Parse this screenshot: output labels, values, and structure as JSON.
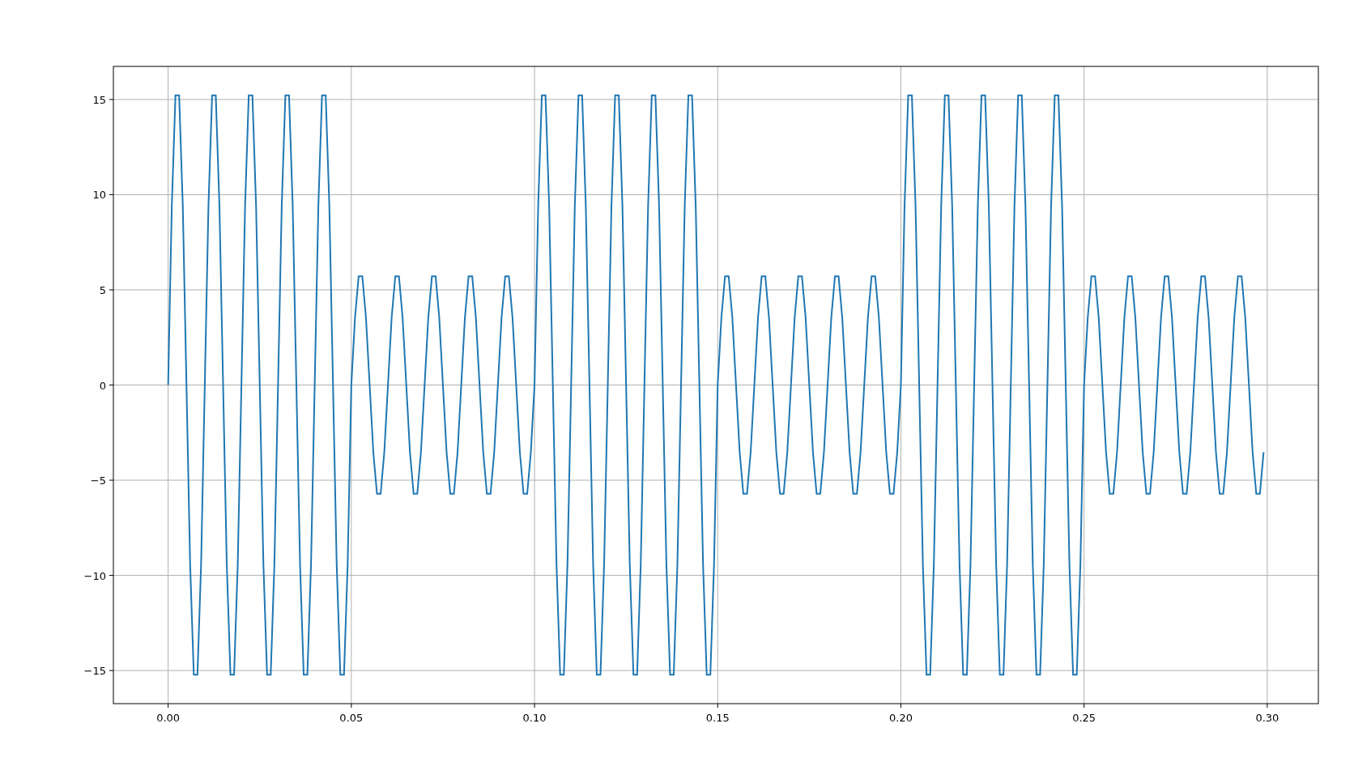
{
  "chart_data": {
    "type": "line",
    "grid": true,
    "x": [
      0,
      0.001,
      0.002,
      0.003,
      0.004,
      0.005,
      0.006,
      0.007,
      0.008,
      0.009,
      0.01,
      0.011,
      0.012,
      0.013,
      0.014,
      0.015,
      0.016,
      0.017,
      0.018,
      0.019,
      0.02,
      0.021,
      0.022,
      0.023,
      0.024,
      0.025,
      0.026,
      0.027,
      0.028,
      0.029,
      0.03,
      0.031,
      0.032,
      0.033,
      0.034,
      0.035,
      0.036,
      0.037,
      0.038,
      0.039,
      0.04,
      0.041,
      0.042,
      0.043,
      0.044,
      0.045,
      0.046,
      0.047,
      0.048,
      0.049,
      0.05,
      0.051,
      0.052,
      0.053,
      0.054,
      0.055,
      0.056,
      0.057,
      0.058,
      0.059,
      0.06,
      0.061,
      0.062,
      0.063,
      0.064,
      0.065,
      0.066,
      0.067,
      0.068,
      0.069,
      0.07,
      0.071,
      0.072,
      0.073,
      0.074,
      0.075,
      0.076,
      0.077,
      0.078,
      0.079,
      0.08,
      0.081,
      0.082,
      0.083,
      0.084,
      0.085,
      0.086,
      0.087,
      0.088,
      0.089,
      0.09,
      0.091,
      0.092,
      0.093,
      0.094,
      0.095,
      0.096,
      0.097,
      0.098,
      0.099,
      0.1,
      0.101,
      0.102,
      0.103,
      0.104,
      0.105,
      0.106,
      0.107,
      0.108,
      0.109,
      0.11,
      0.111,
      0.112,
      0.113,
      0.114,
      0.115,
      0.116,
      0.117,
      0.118,
      0.119,
      0.12,
      0.121,
      0.122,
      0.123,
      0.124,
      0.125,
      0.126,
      0.127,
      0.128,
      0.129,
      0.13,
      0.131,
      0.132,
      0.133,
      0.134,
      0.135,
      0.136,
      0.137,
      0.138,
      0.139,
      0.14,
      0.141,
      0.142,
      0.143,
      0.144,
      0.145,
      0.146,
      0.147,
      0.148,
      0.149,
      0.15,
      0.151,
      0.152,
      0.153,
      0.154,
      0.155,
      0.156,
      0.157,
      0.158,
      0.159,
      0.16,
      0.161,
      0.162,
      0.163,
      0.164,
      0.165,
      0.166,
      0.167,
      0.168,
      0.169,
      0.17,
      0.171,
      0.172,
      0.173,
      0.174,
      0.175,
      0.176,
      0.177,
      0.178,
      0.179,
      0.18,
      0.181,
      0.182,
      0.183,
      0.184,
      0.185,
      0.186,
      0.187,
      0.188,
      0.189,
      0.19,
      0.191,
      0.192,
      0.193,
      0.194,
      0.195,
      0.196,
      0.197,
      0.198,
      0.199,
      0.2,
      0.201,
      0.202,
      0.203,
      0.204,
      0.205,
      0.206,
      0.207,
      0.208,
      0.209,
      0.21,
      0.211,
      0.212,
      0.213,
      0.214,
      0.215,
      0.216,
      0.217,
      0.218,
      0.219,
      0.22,
      0.221,
      0.222,
      0.223,
      0.224,
      0.225,
      0.226,
      0.227,
      0.228,
      0.229,
      0.23,
      0.231,
      0.232,
      0.233,
      0.234,
      0.235,
      0.236,
      0.237,
      0.238,
      0.239,
      0.24,
      0.241,
      0.242,
      0.243,
      0.244,
      0.245,
      0.246,
      0.247,
      0.248,
      0.249,
      0.25,
      0.251,
      0.252,
      0.253,
      0.254,
      0.255,
      0.256,
      0.257,
      0.258,
      0.259,
      0.26,
      0.261,
      0.262,
      0.263,
      0.264,
      0.265,
      0.266,
      0.267,
      0.268,
      0.269,
      0.27,
      0.271,
      0.272,
      0.273,
      0.274,
      0.275,
      0.276,
      0.277,
      0.278,
      0.279,
      0.28,
      0.281,
      0.282,
      0.283,
      0.284,
      0.285,
      0.286,
      0.287,
      0.288,
      0.289,
      0.29,
      0.291,
      0.292,
      0.293,
      0.294,
      0.295,
      0.296,
      0.297,
      0.298,
      0.299
    ],
    "series": [
      {
        "color": "#1f77b4",
        "values": [
          0,
          9.4,
          15.22,
          15.22,
          9.4,
          0,
          -9.4,
          -15.22,
          -15.22,
          -9.4,
          0,
          9.4,
          15.22,
          15.22,
          9.4,
          0,
          -9.4,
          -15.22,
          -15.22,
          -9.4,
          0,
          9.4,
          15.22,
          15.22,
          9.4,
          0,
          -9.4,
          -15.22,
          -15.22,
          -9.4,
          0,
          9.4,
          15.22,
          15.22,
          9.4,
          0,
          -9.4,
          -15.22,
          -15.22,
          -9.4,
          0,
          9.4,
          15.22,
          15.22,
          9.4,
          0,
          -9.4,
          -15.22,
          -15.22,
          -9.4,
          0,
          3.53,
          5.71,
          5.71,
          3.53,
          0,
          -3.53,
          -5.71,
          -5.71,
          -3.53,
          0,
          3.53,
          5.71,
          5.71,
          3.53,
          0,
          -3.53,
          -5.71,
          -5.71,
          -3.53,
          0,
          3.53,
          5.71,
          5.71,
          3.53,
          0,
          -3.53,
          -5.71,
          -5.71,
          -3.53,
          0,
          3.53,
          5.71,
          5.71,
          3.53,
          0,
          -3.53,
          -5.71,
          -5.71,
          -3.53,
          0,
          3.53,
          5.71,
          5.71,
          3.53,
          0,
          -3.53,
          -5.71,
          -5.71,
          -3.53,
          0,
          9.4,
          15.22,
          15.22,
          9.4,
          0,
          -9.4,
          -15.22,
          -15.22,
          -9.4,
          0,
          9.4,
          15.22,
          15.22,
          9.4,
          0,
          -9.4,
          -15.22,
          -15.22,
          -9.4,
          0,
          9.4,
          15.22,
          15.22,
          9.4,
          0,
          -9.4,
          -15.22,
          -15.22,
          -9.4,
          0,
          9.4,
          15.22,
          15.22,
          9.4,
          0,
          -9.4,
          -15.22,
          -15.22,
          -9.4,
          0,
          9.4,
          15.22,
          15.22,
          9.4,
          0,
          -9.4,
          -15.22,
          -15.22,
          -9.4,
          0,
          3.53,
          5.71,
          5.71,
          3.53,
          0,
          -3.53,
          -5.71,
          -5.71,
          -3.53,
          0,
          3.53,
          5.71,
          5.71,
          3.53,
          0,
          -3.53,
          -5.71,
          -5.71,
          -3.53,
          0,
          3.53,
          5.71,
          5.71,
          3.53,
          0,
          -3.53,
          -5.71,
          -5.71,
          -3.53,
          0,
          3.53,
          5.71,
          5.71,
          3.53,
          0,
          -3.53,
          -5.71,
          -5.71,
          -3.53,
          0,
          3.53,
          5.71,
          5.71,
          3.53,
          0,
          -3.53,
          -5.71,
          -5.71,
          -3.53,
          0,
          9.4,
          15.22,
          15.22,
          9.4,
          0,
          -9.4,
          -15.22,
          -15.22,
          -9.4,
          0,
          9.4,
          15.22,
          15.22,
          9.4,
          0,
          -9.4,
          -15.22,
          -15.22,
          -9.4,
          0,
          9.4,
          15.22,
          15.22,
          9.4,
          0,
          -9.4,
          -15.22,
          -15.22,
          -9.4,
          0,
          9.4,
          15.22,
          15.22,
          9.4,
          0,
          -9.4,
          -15.22,
          -15.22,
          -9.4,
          0,
          9.4,
          15.22,
          15.22,
          9.4,
          0,
          -9.4,
          -15.22,
          -15.22,
          -9.4,
          0,
          3.53,
          5.71,
          5.71,
          3.53,
          0,
          -3.53,
          -5.71,
          -5.71,
          -3.53,
          0,
          3.53,
          5.71,
          5.71,
          3.53,
          0,
          -3.53,
          -5.71,
          -5.71,
          -3.53,
          0,
          3.53,
          5.71,
          5.71,
          3.53,
          0,
          -3.53,
          -5.71,
          -5.71,
          -3.53,
          0,
          3.53,
          5.71,
          5.71,
          3.53,
          0,
          -3.53,
          -5.71,
          -5.71,
          -3.53,
          0,
          3.53,
          5.71,
          5.71,
          3.53,
          0,
          -3.53,
          -5.71,
          -5.71,
          -3.53
        ]
      }
    ],
    "xlim": [
      -0.01495,
      0.31395
    ],
    "ylim": [
      -16.74,
      16.74
    ],
    "xticks": [
      {
        "value": 0,
        "label": "0.00"
      },
      {
        "value": 0.05,
        "label": "0.05"
      },
      {
        "value": 0.1,
        "label": "0.10"
      },
      {
        "value": 0.15,
        "label": "0.15"
      },
      {
        "value": 0.2,
        "label": "0.20"
      },
      {
        "value": 0.25,
        "label": "0.25"
      },
      {
        "value": 0.3,
        "label": "0.30"
      }
    ],
    "yticks": [
      {
        "value": -15,
        "label": "−15"
      },
      {
        "value": -10,
        "label": "−10"
      },
      {
        "value": -5,
        "label": "−5"
      },
      {
        "value": 0,
        "label": "0"
      },
      {
        "value": 5,
        "label": "5"
      },
      {
        "value": 10,
        "label": "10"
      },
      {
        "value": 15,
        "label": "15"
      }
    ]
  }
}
